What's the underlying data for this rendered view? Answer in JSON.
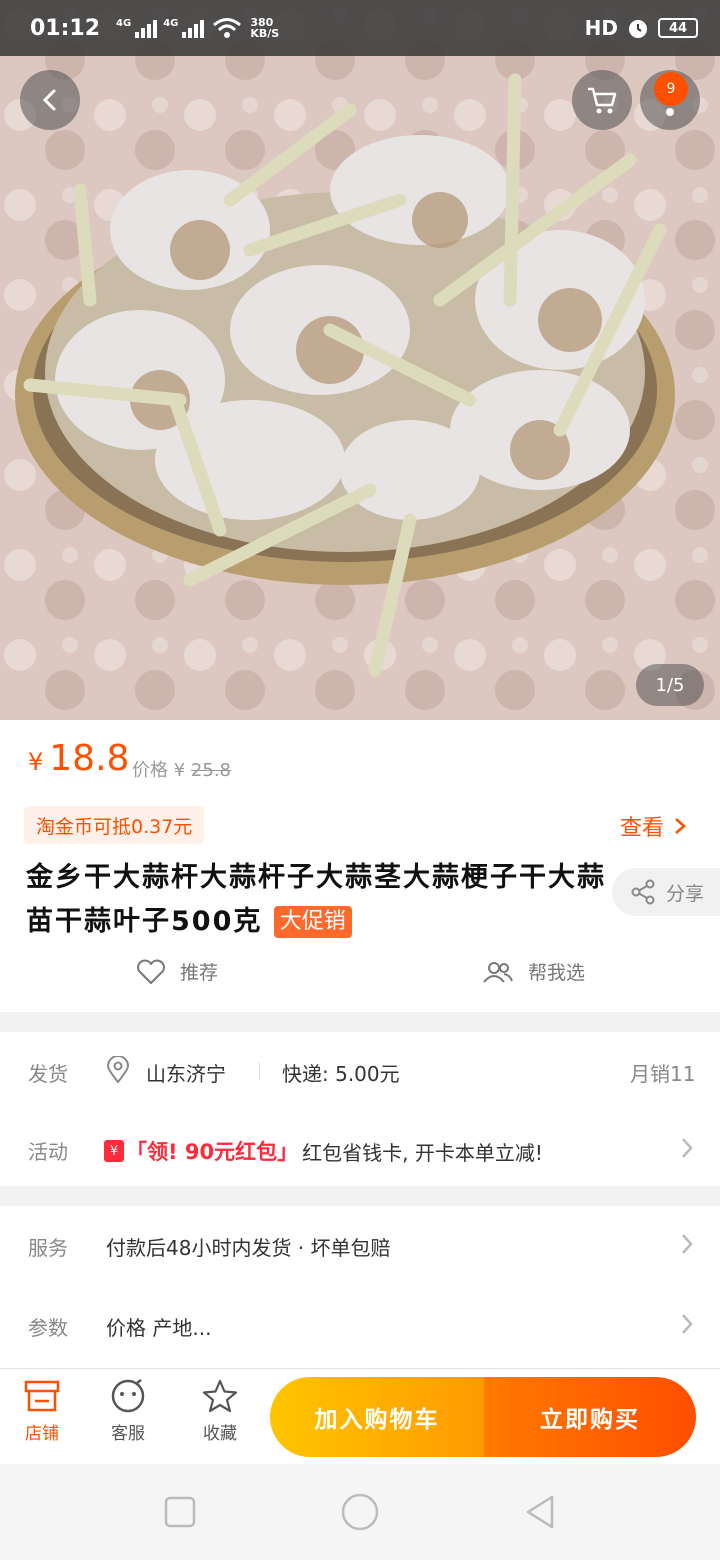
{
  "status_bar": {
    "time": "01:12",
    "net1": "4G",
    "net2": "4G",
    "speed_top": "380",
    "speed_bottom": "KB/S",
    "hd": "HD",
    "battery": "44"
  },
  "hero": {
    "cart_badge": "9",
    "pager": "1/5",
    "photo_subject": "dried garlic stalks in a woven bamboo basket"
  },
  "price": {
    "currency": "¥",
    "current": "18.8",
    "original_label": "价格",
    "original_currency": "¥",
    "original": "25.8"
  },
  "coin": {
    "text": "淘金币可抵0.37元"
  },
  "view": {
    "label": "查看"
  },
  "title": {
    "text": "金乡干大蒜杆大蒜杆子大蒜茎大蒜梗子干大蒜苗干蒜叶子500克",
    "promo": "大促销"
  },
  "share": {
    "label": "分享"
  },
  "actions": {
    "recommend": "推荐",
    "help_choose": "帮我选"
  },
  "shipping": {
    "label": "发货",
    "location": "山东济宁",
    "express": "快递: 5.00元",
    "monthly_sales": "月销11"
  },
  "activity": {
    "label": "活动",
    "coupon_icon": "¥",
    "coupon": "「领! 90元红包」",
    "text": "红包省钱卡, 开卡本单立减!"
  },
  "service": {
    "label": "服务",
    "text": "付款后48小时内发货 · 坏单包赔"
  },
  "params": {
    "label": "参数",
    "text": "价格 产地..."
  },
  "bottom_bar": {
    "store": "店铺",
    "service": "客服",
    "favorite": "收藏",
    "add_to_cart": "加入购物车",
    "buy_now": "立即购买"
  },
  "colors": {
    "accent": "#ff5000",
    "cart_button": "#ffb300",
    "buy_button": "#ff5a00"
  }
}
